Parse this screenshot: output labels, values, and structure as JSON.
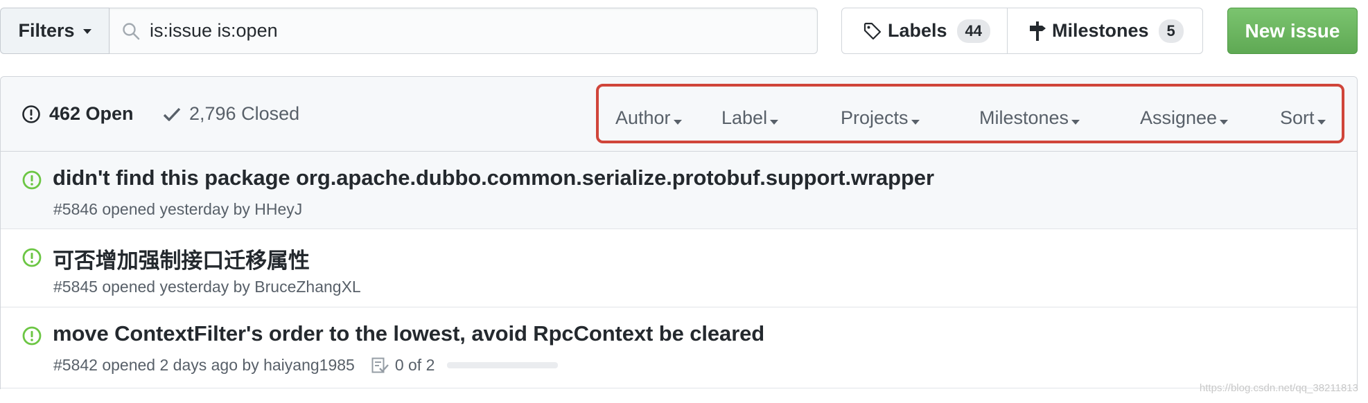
{
  "toolbar": {
    "filters_label": "Filters",
    "search_value": "is:issue is:open",
    "labels_label": "Labels",
    "labels_count": "44",
    "milestones_label": "Milestones",
    "milestones_count": "5",
    "new_issue_label": "New issue",
    "accent_color": "#6cbf5f"
  },
  "issues_header": {
    "open_label": "462 Open",
    "closed_label": "2,796 Closed",
    "filters": [
      {
        "label": "Author"
      },
      {
        "label": "Label"
      },
      {
        "label": "Projects"
      },
      {
        "label": "Milestones"
      },
      {
        "label": "Assignee"
      },
      {
        "label": "Sort"
      }
    ],
    "highlight_color": "#d0453a"
  },
  "issues": [
    {
      "title": "didn't find this package org.apache.dubbo.common.serialize.protobuf.support.wrapper",
      "meta": "#5846 opened yesterday by HHeyJ"
    },
    {
      "title": "可否增加强制接口迁移属性",
      "meta": "#5845 opened yesterday by BruceZhangXL"
    },
    {
      "title": "move ContextFilter's order to the lowest, avoid RpcContext be cleared",
      "meta": "#5842 opened 2 days ago by haiyang1985",
      "tasks": "0 of 2",
      "tasks_progress": 0
    }
  ],
  "watermark": "https://blog.csdn.net/qq_38211813",
  "icons": {
    "search": "search-icon",
    "tag": "tag-icon",
    "milestone": "milestone-icon",
    "issue_open": "issue-opened-icon",
    "check": "check-icon",
    "tasklist": "tasklist-icon"
  }
}
